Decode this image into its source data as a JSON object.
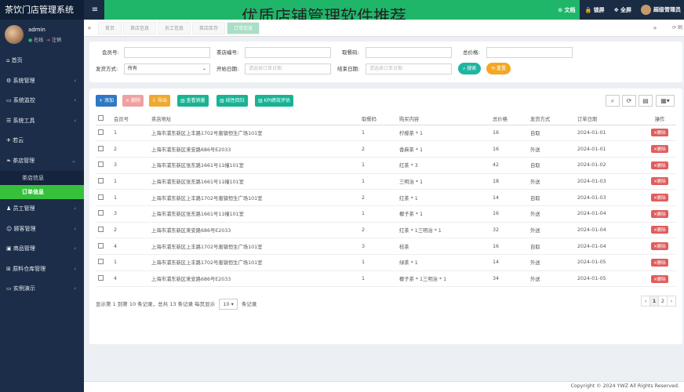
{
  "app": {
    "brand": "茶饮门店管理系统",
    "overlay_title": "优质店铺管理软件推荐"
  },
  "header": {
    "links": [
      "文档",
      "锁屏",
      "全屏",
      "超级管理员"
    ]
  },
  "user": {
    "name": "admin",
    "online": "在线",
    "logout": "注销"
  },
  "sidebar": {
    "items": [
      {
        "icon": "home-icon",
        "label": "首页",
        "caret": ""
      },
      {
        "icon": "gear-icon",
        "label": "系统管理",
        "caret": "‹"
      },
      {
        "icon": "monitor-icon",
        "label": "系统监控",
        "caret": "‹"
      },
      {
        "icon": "toolbox-icon",
        "label": "系统工具",
        "caret": "‹"
      },
      {
        "icon": "plane-icon",
        "label": "若云",
        "caret": ""
      },
      {
        "icon": "leaf-icon",
        "label": "茶店管理",
        "caret": "⌄"
      }
    ],
    "sub": [
      "茶店信息",
      "订单信息"
    ],
    "items2": [
      {
        "icon": "users-icon",
        "label": "员工管理",
        "caret": "‹"
      },
      {
        "icon": "customers-icon",
        "label": "顾客管理",
        "caret": "‹"
      },
      {
        "icon": "goods-icon",
        "label": "商品管理",
        "caret": "‹"
      },
      {
        "icon": "warehouse-icon",
        "label": "原料仓库管理",
        "caret": "‹"
      },
      {
        "icon": "demo-icon",
        "label": "实例演示",
        "caret": "‹"
      }
    ]
  },
  "tabs": [
    "首页",
    "茶店信息",
    "员工信息",
    "茶店库存",
    "订单信息"
  ],
  "search": {
    "member_label": "会员号:",
    "shop_label": "茶店编号:",
    "code_label": "取餐码:",
    "total_label": "总价格:",
    "delivery_label": "发货方式:",
    "delivery_value": "所有",
    "start_label": "开始日期:",
    "start_placeholder": "请选择订单日期",
    "end_label": "结束日期:",
    "end_placeholder": "请选择订单日期",
    "search_btn": "搜索",
    "reset_btn": "重置"
  },
  "toolbar": [
    "添加",
    "删除",
    "导出",
    "查看销量",
    "线性回归",
    "KPI绩效评估"
  ],
  "table": {
    "headers": [
      "会员号",
      "茶店地址",
      "取餐码",
      "购买内容",
      "总价格",
      "发货方式",
      "订单日期",
      "操作"
    ],
    "rows": [
      [
        "1",
        "上海市浦东新区上丰路1702号唐镇恒生广场101室",
        "1",
        "柠檬茶 * 1",
        "16",
        "自取",
        "2024-01-01"
      ],
      [
        "2",
        "上海市浦东新区来安路686号E2033",
        "2",
        "香麻茶 * 1",
        "16",
        "外送",
        "2024-01-01"
      ],
      [
        "3",
        "上海市浦东新区张东路1661号11幢101室",
        "1",
        "红茶 * 3",
        "42",
        "自取",
        "2024-01-02"
      ],
      [
        "1",
        "上海市浦东新区张东路1661号11幢101室",
        "1",
        "三明治 * 1",
        "18",
        "外送",
        "2024-01-03"
      ],
      [
        "1",
        "上海市浦东新区上丰路1702号唐镇恒生广场101室",
        "2",
        "红茶 * 1",
        "14",
        "自取",
        "2024-01-03"
      ],
      [
        "3",
        "上海市浦东新区张东路1661号11幢101室",
        "1",
        "椰子茶 * 1",
        "16",
        "外送",
        "2024-01-04"
      ],
      [
        "2",
        "上海市浦东新区来安路686号E2033",
        "2",
        "红茶 * 1三明治 * 1",
        "32",
        "外送",
        "2024-01-04"
      ],
      [
        "4",
        "上海市浦东新区上丰路1702号唐镇恒生广场101室",
        "3",
        "桔茶",
        "16",
        "自取",
        "2024-01-04"
      ],
      [
        "1",
        "上海市浦东新区上丰路1702号唐镇恒生广场101室",
        "1",
        "绿茶 * 1",
        "14",
        "外送",
        "2024-01-05"
      ],
      [
        "4",
        "上海市浦东新区来安路686号E2033",
        "1",
        "椰子茶 * 1三明治 * 1",
        "34",
        "外送",
        "2024-01-05"
      ]
    ],
    "delete_label": "删除"
  },
  "pager": {
    "summary": "显示第 1 到第 10 条记录，总共 13 条记录 每页显示",
    "size": "10",
    "suffix": "条记录",
    "pages": [
      "‹",
      "1",
      "2",
      "›"
    ]
  },
  "footer": "Copyright © 2024 YWZ All Rights Reserved."
}
